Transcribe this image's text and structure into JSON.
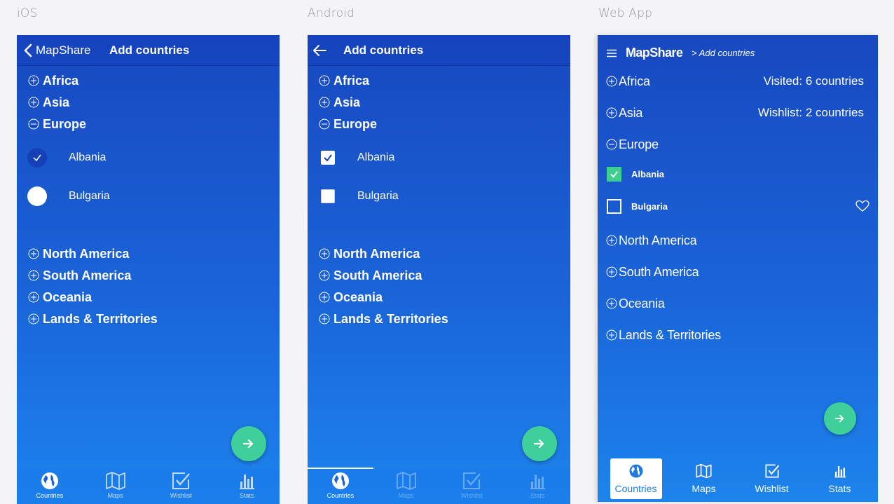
{
  "labels": {
    "ios": "iOS",
    "android": "Android",
    "web": "Web App"
  },
  "ios": {
    "app_name": "MapShare",
    "title": "Add countries",
    "continents_top": [
      "Africa",
      "Asia",
      "Europe"
    ],
    "countries": [
      {
        "name": "Albania",
        "checked": true
      },
      {
        "name": "Bulgaria",
        "checked": false
      }
    ],
    "continents_bottom": [
      "North America",
      "South America",
      "Oceania",
      "Lands & Territories"
    ],
    "tabs": [
      "Countries",
      "Maps",
      "Wishlist",
      "Stats"
    ]
  },
  "android": {
    "title": "Add countries",
    "continents_top": [
      "Africa",
      "Asia",
      "Europe"
    ],
    "countries": [
      {
        "name": "Albania",
        "checked": true
      },
      {
        "name": "Bulgaria",
        "checked": false
      }
    ],
    "continents_bottom": [
      "North America",
      "South America",
      "Oceania",
      "Lands & Territories"
    ],
    "tabs": [
      "Countries",
      "Maps",
      "Wishlist",
      "Stats"
    ]
  },
  "web": {
    "brand": "MapShare",
    "breadcrumb": "> Add countries",
    "visited": "Visited: 6 countries",
    "wishlist": "Wishlist: 2 countries",
    "continents_top": [
      "Africa",
      "Asia",
      "Europe"
    ],
    "countries": [
      {
        "name": "Albania",
        "checked": true
      },
      {
        "name": "Bulgaria",
        "checked": false
      }
    ],
    "continents_bottom": [
      "North America",
      "South America",
      "Oceania",
      "Lands & Territories"
    ],
    "tabs": [
      "Countries",
      "Maps",
      "Wishlist",
      "Stats"
    ]
  },
  "colors": {
    "accent": "#3ecf9a",
    "bg_top": "#1848c0",
    "bg_bottom": "#1d84ec",
    "check_web": "#3ecf8e"
  }
}
